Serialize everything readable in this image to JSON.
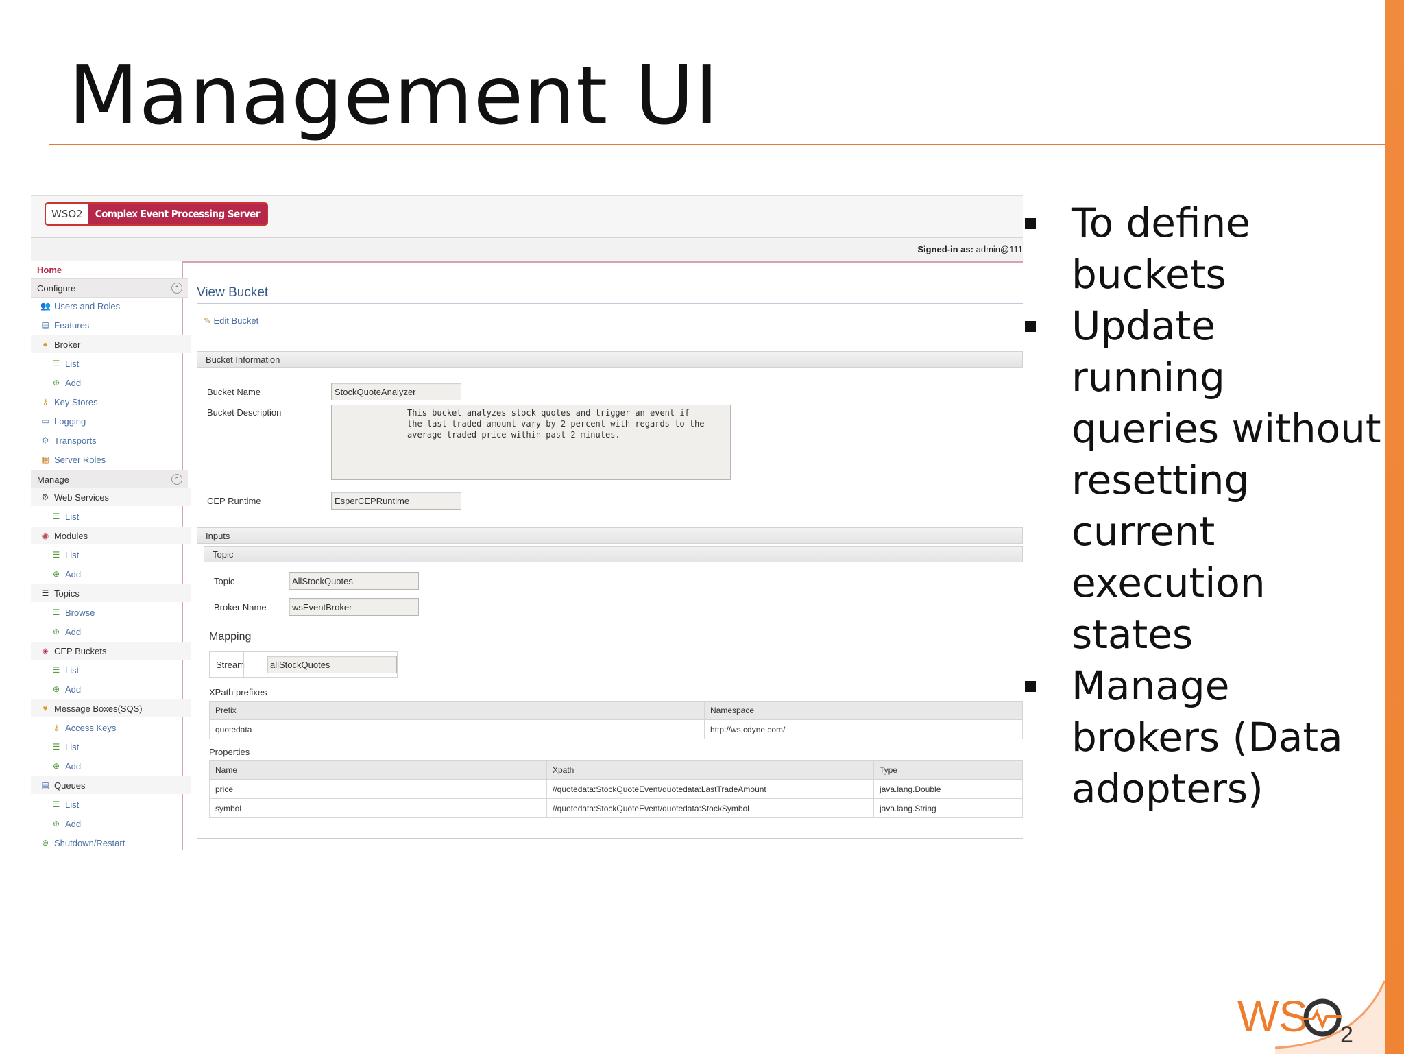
{
  "slide": {
    "title": "Management UI",
    "bullets": [
      "To define buckets",
      "Update running queries without resetting current execution states",
      "Manage brokers (Data adopters)"
    ],
    "logo_text": "WSO2",
    "accent_color": "#e8773a"
  },
  "app": {
    "brand_logo": "WSO2",
    "product_name": "Complex Event Processing Server",
    "signed_in_label": "Signed-in as:",
    "signed_in_user": "admin@111"
  },
  "sidebar": {
    "home": "Home",
    "configure": "Configure",
    "configure_items": {
      "users_roles": "Users and Roles",
      "features": "Features",
      "broker": "Broker",
      "broker_list": "List",
      "broker_add": "Add",
      "key_stores": "Key Stores",
      "logging": "Logging",
      "transports": "Transports",
      "server_roles": "Server Roles"
    },
    "manage": "Manage",
    "manage_items": {
      "web_services": "Web Services",
      "ws_list": "List",
      "modules": "Modules",
      "modules_list": "List",
      "modules_add": "Add",
      "topics": "Topics",
      "topics_browse": "Browse",
      "topics_add": "Add",
      "cep_buckets": "CEP Buckets",
      "cep_list": "List",
      "cep_add": "Add",
      "message_boxes": "Message Boxes(SQS)",
      "access_keys": "Access Keys",
      "mb_list": "List",
      "mb_add": "Add",
      "queues": "Queues",
      "queues_list": "List",
      "queues_add": "Add",
      "shutdown": "Shutdown/Restart"
    }
  },
  "main": {
    "page_title": "View Bucket",
    "edit_link": "Edit Bucket",
    "bucket_info_header": "Bucket Information",
    "bucket_name_label": "Bucket Name",
    "bucket_name": "StockQuoteAnalyzer",
    "bucket_description_label": "Bucket Description",
    "bucket_description": "This bucket analyzes stock quotes and trigger an event if\nthe last traded amount vary by 2 percent with regards to the\naverage traded price within past 2 minutes.",
    "cep_runtime_label": "CEP Runtime",
    "cep_runtime": "EsperCEPRuntime",
    "inputs_header": "Inputs",
    "topic_header": "Topic",
    "topic_label": "Topic",
    "topic": "AllStockQuotes",
    "broker_name_label": "Broker Name",
    "broker_name": "wsEventBroker",
    "mapping_label": "Mapping",
    "stream_label": "Stream",
    "stream": "allStockQuotes",
    "xpath_prefixes_label": "XPath prefixes",
    "prefix_table": {
      "headers": [
        "Prefix",
        "Namespace"
      ],
      "rows": [
        [
          "quotedata",
          "http://ws.cdyne.com/"
        ]
      ]
    },
    "properties_label": "Properties",
    "properties_table": {
      "headers": [
        "Name",
        "Xpath",
        "Type"
      ],
      "rows": [
        [
          "price",
          "//quotedata:StockQuoteEvent/quotedata:LastTradeAmount",
          "java.lang.Double"
        ],
        [
          "symbol",
          "//quotedata:StockQuoteEvent/quotedata:StockSymbol",
          "java.lang.String"
        ]
      ]
    }
  }
}
